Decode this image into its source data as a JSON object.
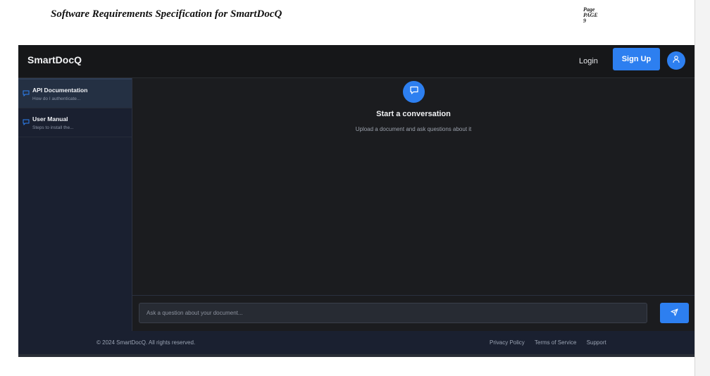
{
  "document": {
    "header_title": "Software Requirements Specification for SmartDocQ",
    "page_label": [
      "Page",
      "PAGE",
      "9"
    ]
  },
  "navbar": {
    "brand": "SmartDocQ",
    "login_label": "Login",
    "signup_label": "Sign Up",
    "avatar_icon": "user-icon"
  },
  "sidebar": {
    "items": [
      {
        "title": "API Documentation",
        "preview": "How do I authenticate...",
        "icon": "chat-bubble-icon",
        "active": true
      },
      {
        "title": "User Manual",
        "preview": "Steps to install the...",
        "icon": "chat-bubble-icon",
        "active": false
      }
    ]
  },
  "main": {
    "icon": "chat-bubble-icon",
    "title": "Start a conversation",
    "subtitle": "Upload a document and ask questions about it"
  },
  "input": {
    "placeholder": "Ask a question about your document...",
    "value": "",
    "send_icon": "send-icon"
  },
  "footer": {
    "copyright": "© 2024 SmartDocQ. All rights reserved.",
    "links": [
      "Privacy Policy",
      "Terms of Service",
      "Support"
    ]
  },
  "colors": {
    "accent": "#2d7ff0",
    "background": "#1b1c1f",
    "sidebar": "#1a2030"
  }
}
